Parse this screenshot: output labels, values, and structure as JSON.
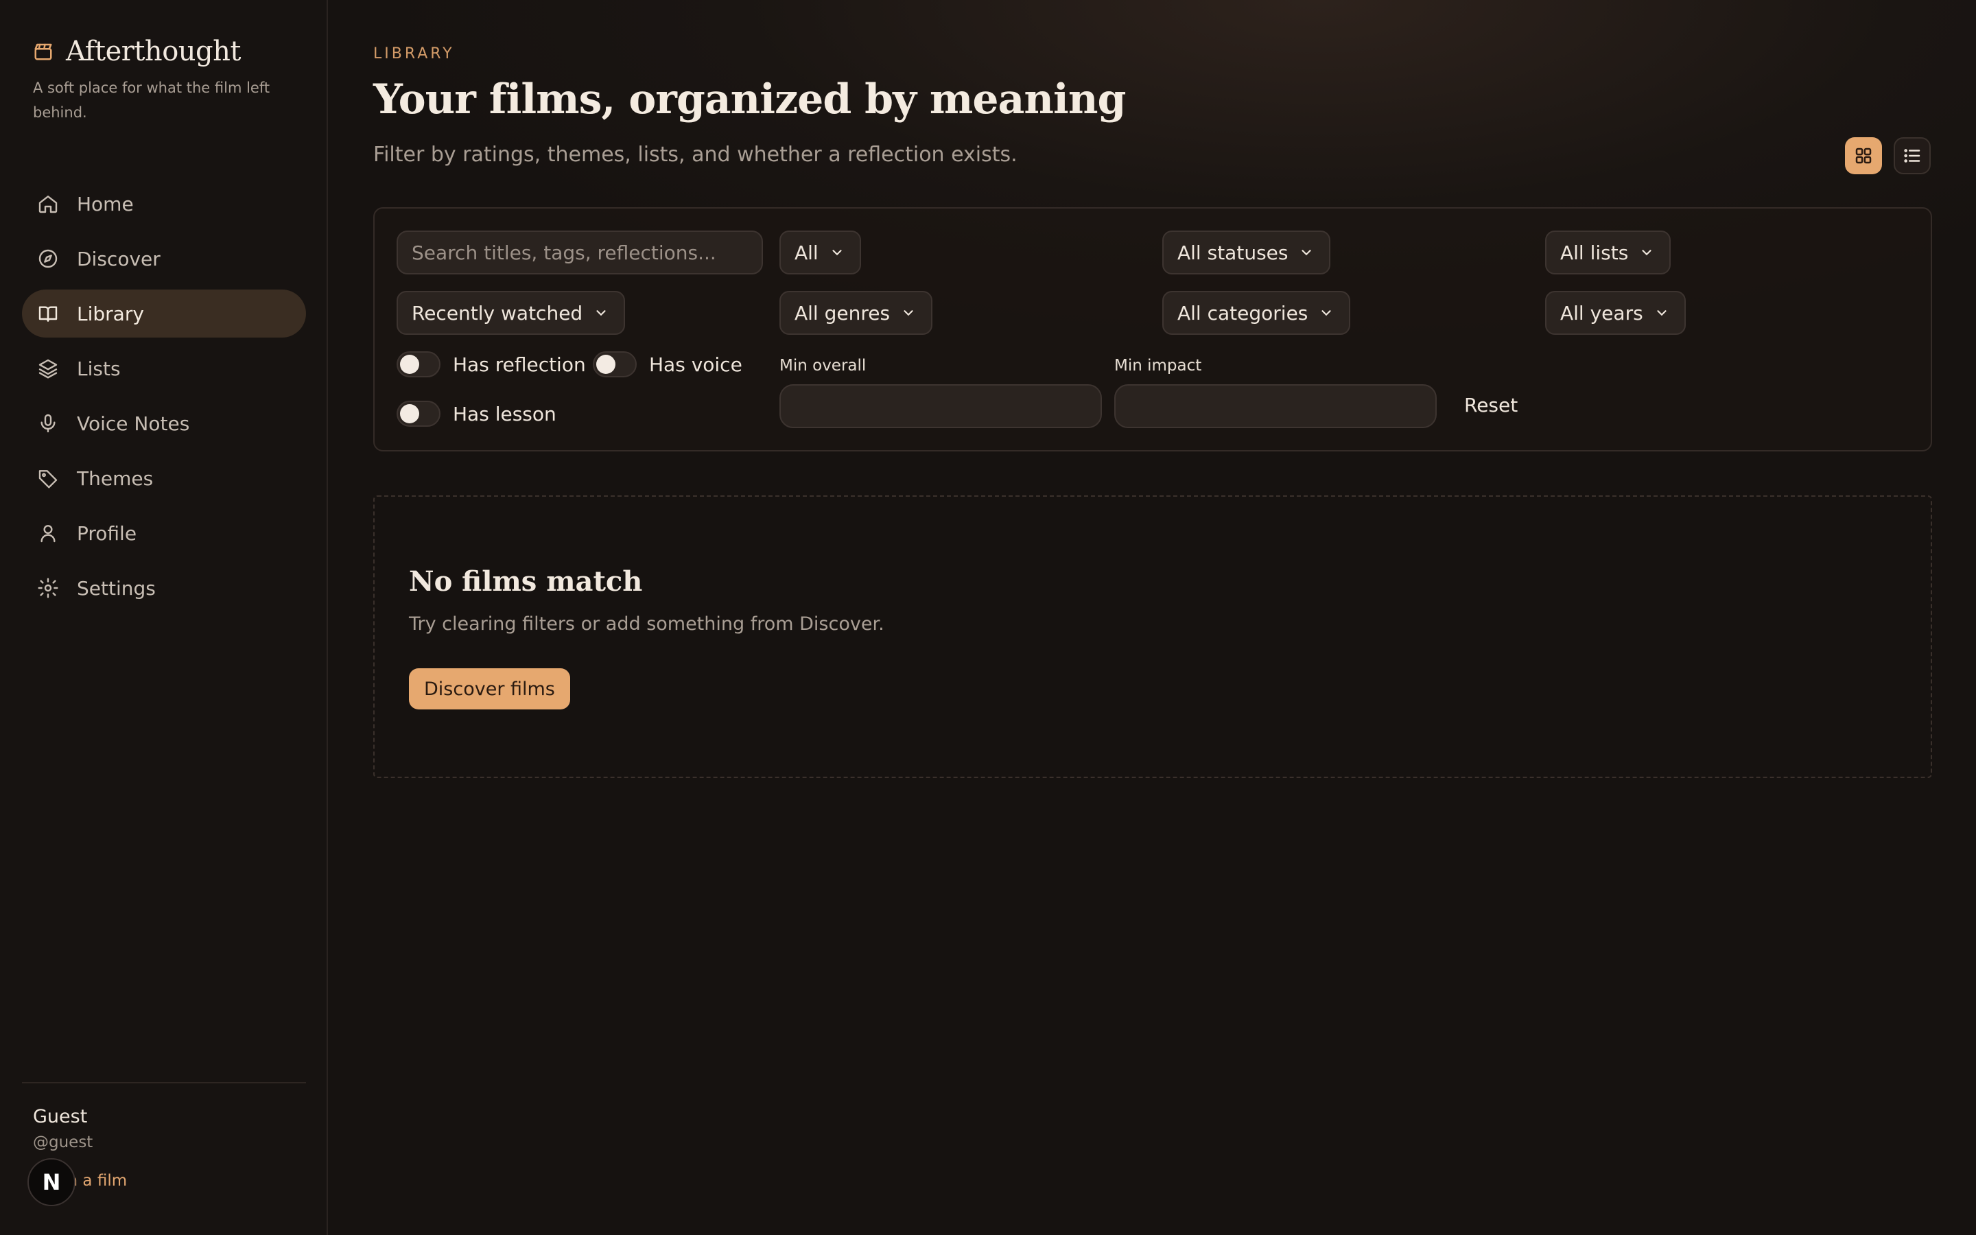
{
  "brand": {
    "name": "Afterthought",
    "tagline": "A soft place for what the film left behind."
  },
  "nav": {
    "items": [
      {
        "label": "Home",
        "icon": "home-icon"
      },
      {
        "label": "Discover",
        "icon": "compass-icon"
      },
      {
        "label": "Library",
        "icon": "book-icon",
        "active": true
      },
      {
        "label": "Lists",
        "icon": "layers-icon"
      },
      {
        "label": "Voice Notes",
        "icon": "mic-icon"
      },
      {
        "label": "Themes",
        "icon": "tag-icon"
      },
      {
        "label": "Profile",
        "icon": "user-icon"
      },
      {
        "label": "Settings",
        "icon": "gear-icon"
      }
    ]
  },
  "user": {
    "name": "Guest",
    "handle": "@guest",
    "link": "t with a film",
    "avatar_letter": "N"
  },
  "header": {
    "eyebrow": "LIBRARY",
    "title": "Your films, organized by meaning",
    "subtitle": "Filter by ratings, themes, lists, and whether a reflection exists."
  },
  "filters": {
    "search_placeholder": "Search titles, tags, reflections...",
    "type": "All",
    "status": "All statuses",
    "list": "All lists",
    "sort": "Recently watched",
    "genre": "All genres",
    "category": "All categories",
    "year": "All years",
    "has_reflection": "Has reflection",
    "has_voice": "Has voice",
    "has_lesson": "Has lesson",
    "min_overall_label": "Min overall",
    "min_impact_label": "Min impact",
    "reset": "Reset"
  },
  "empty": {
    "title": "No films match",
    "description": "Try clearing filters or add something from Discover.",
    "button": "Discover films"
  },
  "colors": {
    "accent": "#e6a86f",
    "background": "#161210",
    "sidebar_active": "#3a2d22"
  }
}
